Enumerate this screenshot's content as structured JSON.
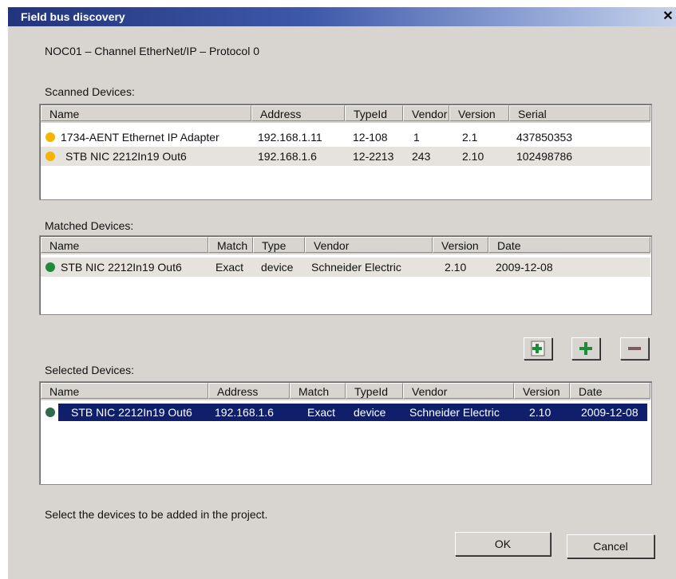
{
  "window": {
    "title": "Field bus discovery",
    "close_glyph": "✕"
  },
  "channel_label": "NOC01 – Channel EtherNet/IP – Protocol 0",
  "scanned": {
    "label": "Scanned Devices:",
    "columns": [
      "Name",
      "Address",
      "TypeId",
      "Vendor",
      "Version",
      "Serial"
    ],
    "rows": [
      {
        "status_color": "#f5b400",
        "name": "1734-AENT Ethernet IP Adapter",
        "address": "192.168.1.11",
        "typeid": "12-108",
        "vendor": "1",
        "version": "2.1",
        "serial": "437850353"
      },
      {
        "status_color": "#f5b400",
        "name": "STB NIC 2212In19 Out6",
        "address": "192.168.1.6",
        "typeid": "12-2213",
        "vendor": "243",
        "version": "2.10",
        "serial": "102498786"
      }
    ]
  },
  "matched": {
    "label": "Matched Devices:",
    "columns": [
      "Name",
      "Match",
      "Type",
      "Vendor",
      "Version",
      "Date"
    ],
    "rows": [
      {
        "status_color": "#1e8a3c",
        "name": "STB NIC 2212In19 Out6",
        "match": "Exact",
        "type": "device",
        "vendor": "Schneider Electric",
        "version": "2.10",
        "date": "2009-12-08"
      }
    ]
  },
  "selected": {
    "label": "Selected Devices:",
    "columns": [
      "Name",
      "Address",
      "Match",
      "TypeId",
      "Vendor",
      "Version",
      "Date"
    ],
    "rows": [
      {
        "status_color": "#2f6b4a",
        "name": "STB NIC 2212In19 Out6",
        "address": "192.168.1.6",
        "match": "Exact",
        "typeid": "device",
        "vendor": "Schneider Electric",
        "version": "2.10",
        "date": "2009-12-08"
      }
    ]
  },
  "toolbar": {
    "add_all_icon": "add-all-icon",
    "add_icon": "plus-icon",
    "remove_icon": "minus-icon",
    "accent_green": "#1e8a3c",
    "remove_color": "#7a5c5c"
  },
  "hint": "Select the devices to be added in the project.",
  "ok_label": "OK",
  "cancel_label": "Cancel"
}
